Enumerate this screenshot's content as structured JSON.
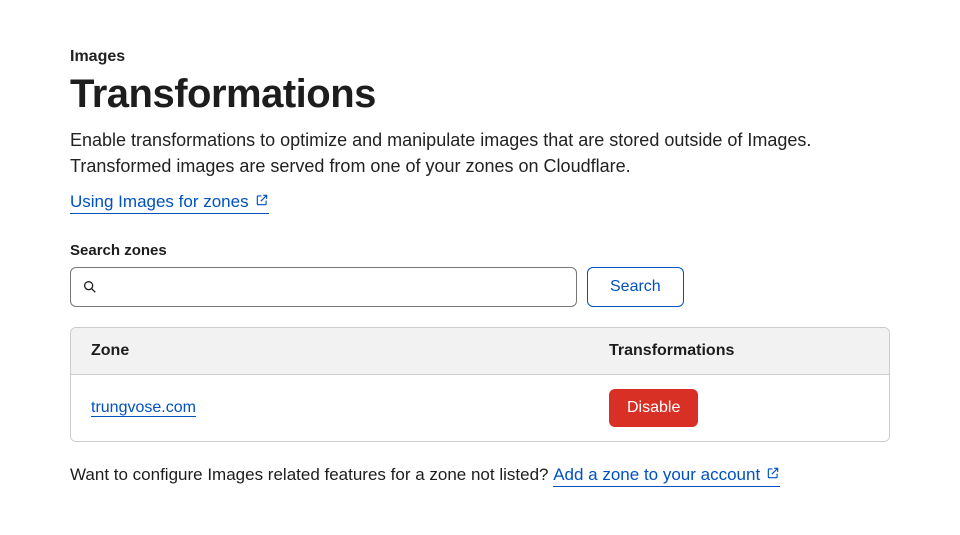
{
  "breadcrumb": "Images",
  "page_title": "Transformations",
  "description": "Enable transformations to optimize and manipulate images that are stored outside of Images. Transformed images are served from one of your zones on Cloudflare.",
  "doc_link": "Using Images for zones",
  "search": {
    "label": "Search zones",
    "placeholder": "",
    "button": "Search"
  },
  "table": {
    "headers": {
      "zone": "Zone",
      "transformations": "Transformations"
    },
    "rows": [
      {
        "zone": "trungvose.com",
        "action": "Disable"
      }
    ]
  },
  "footer": {
    "text": "Want to configure Images related features for a zone not listed? ",
    "link": "Add a zone to your account"
  }
}
